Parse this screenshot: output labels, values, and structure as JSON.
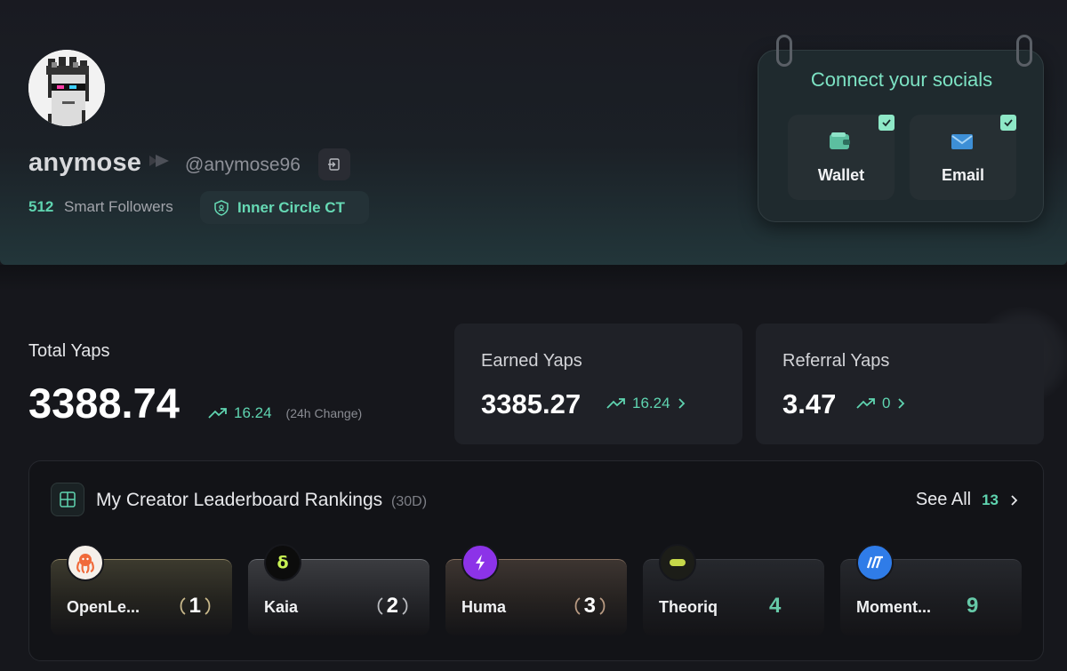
{
  "profile": {
    "display_name": "anymose",
    "handle": "@anymose96",
    "smart_followers_count": "512",
    "smart_followers_label": "Smart Followers",
    "badge_label": "Inner Circle CT"
  },
  "socials": {
    "title": "Connect your socials",
    "tiles": [
      {
        "label": "Wallet",
        "icon": "wallet-icon",
        "connected": true
      },
      {
        "label": "Email",
        "icon": "email-icon",
        "connected": true
      }
    ]
  },
  "yaps": {
    "total_label": "Total Yaps",
    "total_value": "3388.74",
    "total_change": "16.24",
    "total_change_note": "(24h Change)",
    "earned_label": "Earned Yaps",
    "earned_value": "3385.27",
    "earned_change": "16.24",
    "referral_label": "Referral Yaps",
    "referral_value": "3.47",
    "referral_change": "0"
  },
  "leaderboard": {
    "title": "My Creator Leaderboard Rankings",
    "period": "(30D)",
    "see_all_label": "See All",
    "see_all_count": "13",
    "rankings": [
      {
        "project": "OpenLe...",
        "rank": "1",
        "logo": "octopus-icon"
      },
      {
        "project": "Kaia",
        "rank": "2",
        "logo": "kaia-icon"
      },
      {
        "project": "Huma",
        "rank": "3",
        "logo": "huma-icon"
      },
      {
        "project": "Theoriq",
        "rank": "4",
        "logo": "theoriq-icon"
      },
      {
        "project": "Moment...",
        "rank": "9",
        "logo": "moment-icon"
      }
    ]
  },
  "colors": {
    "accent": "#5fd4b0",
    "background": "#16171c",
    "card": "#1f2127",
    "gold": "#b9a77d",
    "silver": "#a7a9ad",
    "bronze": "#a58873"
  }
}
